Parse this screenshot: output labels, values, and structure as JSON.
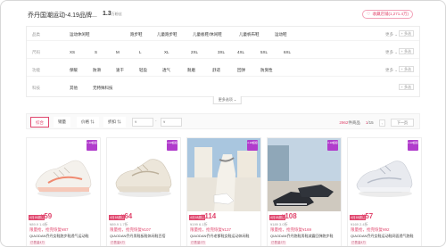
{
  "shop": {
    "name": "乔丹国潮运动-4.19品牌...",
    "fans_value": "1.3",
    "fans_unit": "万粉丝",
    "favorite": "收藏店铺(1,271.4万)"
  },
  "filters": [
    {
      "label": "品类",
      "options": [
        "运动休闲鞋",
        "跑步鞋",
        "儿童跑步鞋",
        "儿童板鞋/休闲鞋",
        "儿童帆布鞋",
        "运动鞋"
      ],
      "more": "更多 ⌄",
      "multi": "+ 多选"
    },
    {
      "label": "尺码",
      "options": [
        "XS",
        "S",
        "M",
        "L",
        "XL",
        "2XL",
        "3XL",
        "4XL",
        "5XL",
        "6XL"
      ],
      "more": "更多 ⌄",
      "multi": "+ 多选"
    },
    {
      "label": "功能",
      "options": [
        "保暖",
        "防滑",
        "速干",
        "轻盈",
        "透气",
        "耐磨",
        "舒适",
        "回弹",
        "防臭性"
      ],
      "more": "更多 ⌄",
      "multi": "+ 多选"
    },
    {
      "label": "科技",
      "options": [
        "其他",
        "无特殊科技"
      ],
      "more": "",
      "multi": "+ 多选"
    }
  ],
  "more_options": "更多选项 ⌄",
  "sort": {
    "tabs": [
      "综合",
      "销量",
      "价格 ⇅",
      "折扣 ⇅"
    ],
    "price_min": "¥",
    "price_max": "¥",
    "dash": "-",
    "count_num": "2962",
    "count_unit": "件商品",
    "page_current": "1",
    "page_total": "/15",
    "prev": "‹",
    "next": "下一页"
  },
  "products": [
    {
      "badge": "4.18超级",
      "tag": "4月18超级",
      "price_symbol": "¥",
      "price": "59",
      "sub": "¥89.9  1.6折",
      "promo": "限量抢，抢完恢复¥87",
      "title": "QIAODAN乔丹女鞋跑步鞋透气运动鞋",
      "sold": "已售量4万"
    },
    {
      "badge": "4.18超级",
      "tag": "4月18超级",
      "price_symbol": "¥",
      "price": "64",
      "sub": "¥89.9  1.7折",
      "promo": "限量抢，抢完恢复¥107",
      "title": "QIAODAN乔丹男鞋板鞋休闲鞋百搭",
      "sold": "已售量4万"
    },
    {
      "badge": "4.18超级",
      "tag": "4月18超级",
      "price_symbol": "¥",
      "price": "114",
      "sub": "¥199  6.1折",
      "promo": "限量抢，抢完恢复¥137",
      "title": "QIAODAN乔丹老爹鞋女鞋运动休闲鞋",
      "sold": "已售量2万"
    },
    {
      "badge": "4.18超级",
      "tag": "4月18超级",
      "price_symbol": "¥",
      "price": "108",
      "sub": "¥189  3.0折",
      "promo": "限量抢，抢完恢复¥169",
      "title": "QIAODAN乔丹跑鞋男鞋减震回弹跑步鞋",
      "sold": "已售量2万"
    },
    {
      "badge": "4.18超级",
      "tag": "4月18超级",
      "price_symbol": "¥",
      "price": "57",
      "sub": "¥169  2.4折",
      "promo": "限量抢，抢完恢复¥92",
      "title": "QIAODAN乔丹女鞋运动鞋网面透气跑鞋",
      "sold": "已售量4万"
    }
  ]
}
